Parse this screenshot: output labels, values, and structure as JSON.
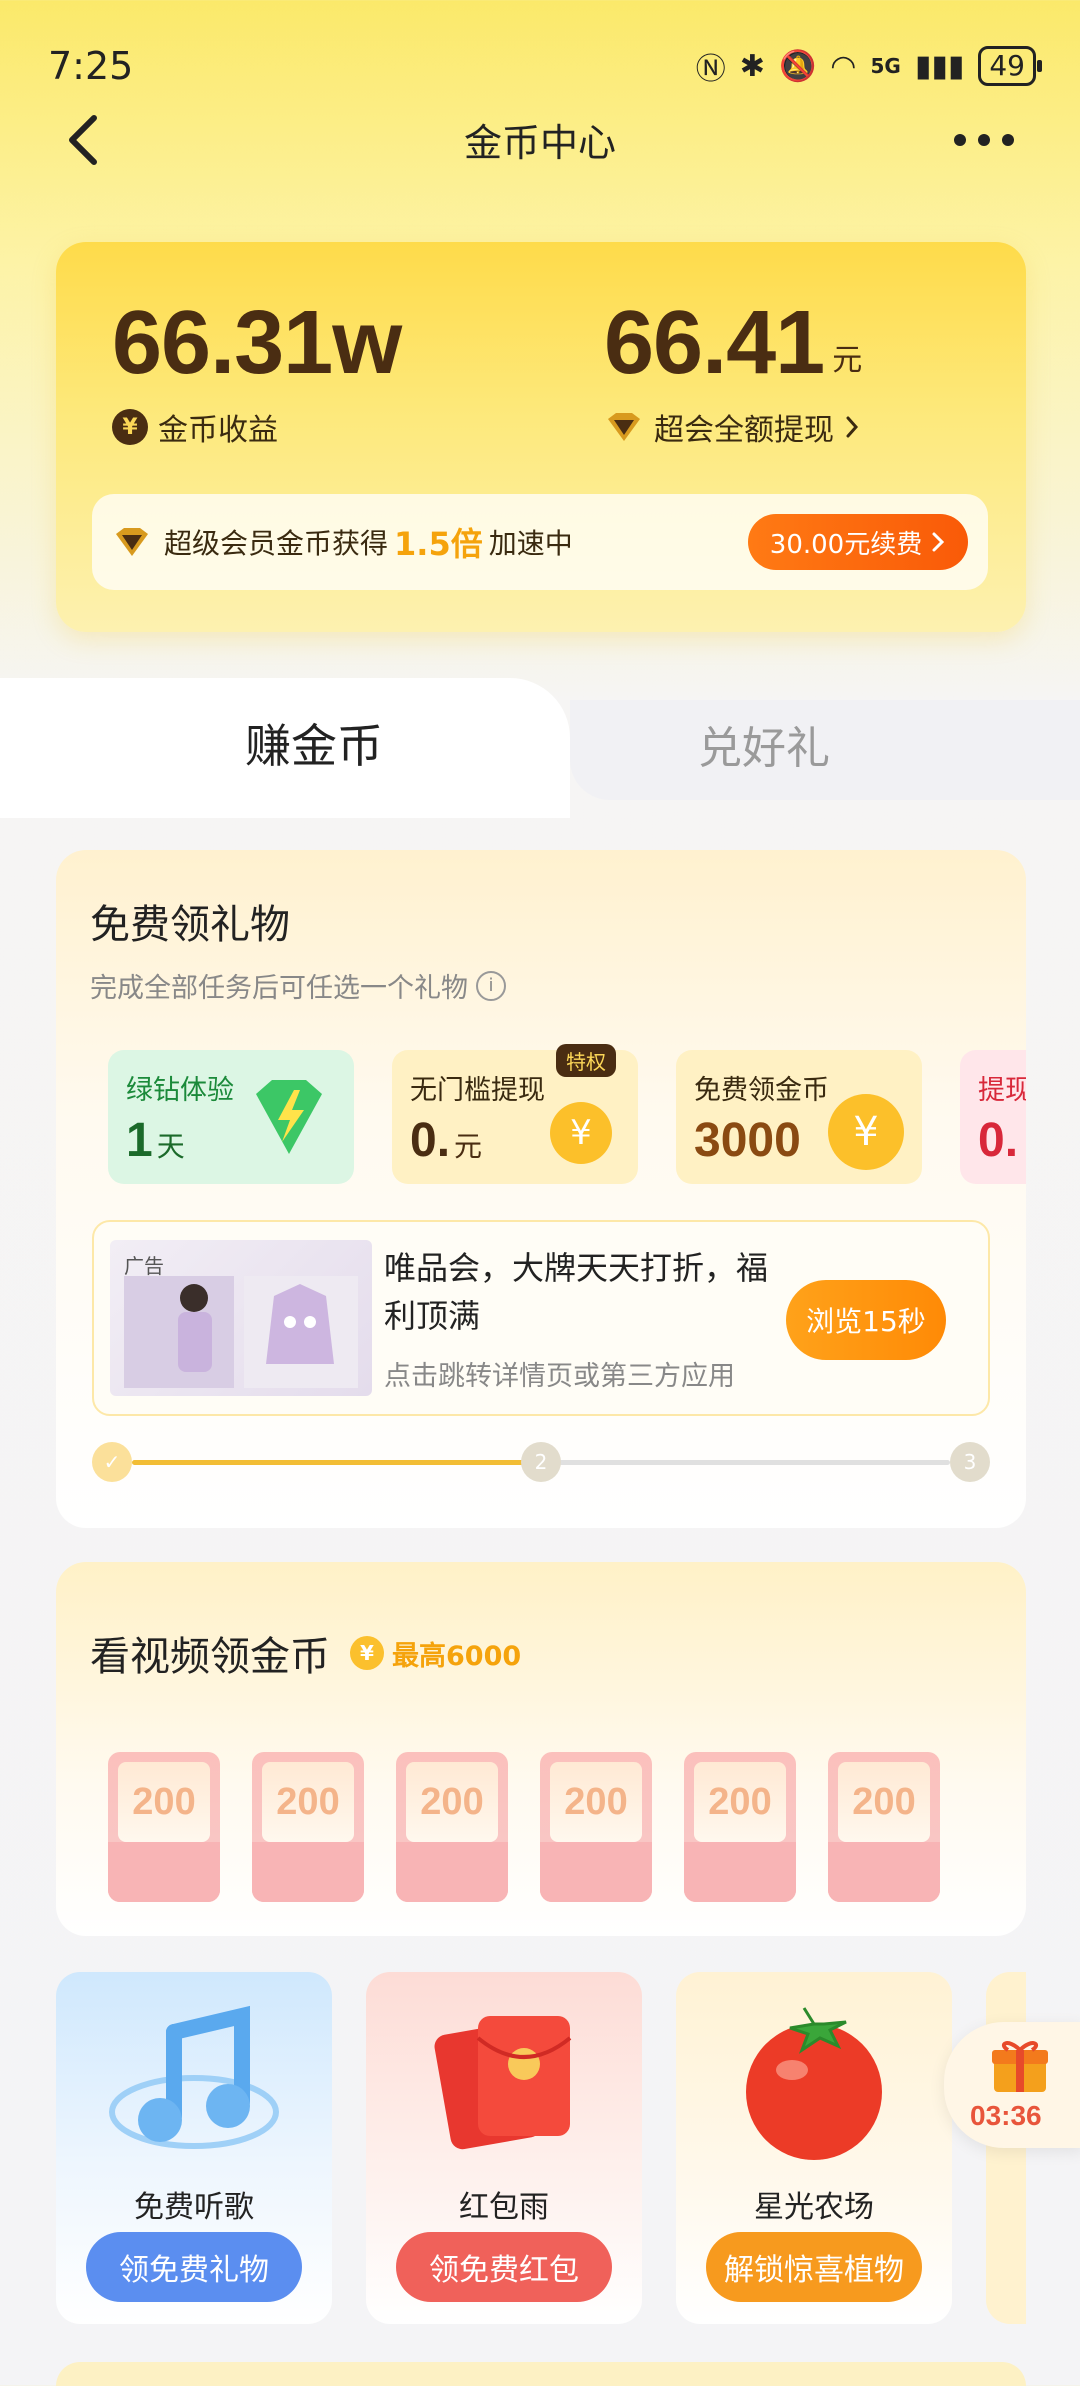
{
  "status": {
    "time": "7:25",
    "battery": "49",
    "network": "5G"
  },
  "nav": {
    "title": "金币中心"
  },
  "balance": {
    "coins_value": "66.31w",
    "coins_label": "金币收益",
    "cash_value": "66.41",
    "cash_unit": "元",
    "cash_label": "超会全额提现",
    "vip_prefix": "超级会员金币获得",
    "vip_multiplier": "1.5倍",
    "vip_suffix": "加速中",
    "renew_label": "30.00元续费"
  },
  "tabs": [
    {
      "label": "赚金币",
      "active": true
    },
    {
      "label": "兑好礼",
      "active": false
    }
  ],
  "gift_section": {
    "title": "免费领礼物",
    "subtitle": "完成全部任务后可任选一个礼物",
    "tiles": [
      {
        "label": "绿钻体验",
        "value": "1",
        "unit": "天",
        "color": "#1b8a3a",
        "bg": "#def7e6"
      },
      {
        "label": "无门槛提现",
        "value": "0.",
        "unit": "元",
        "color": "#4a2d12",
        "bg": "#fff2c6",
        "tag": "特权"
      },
      {
        "label": "免费领金币",
        "value": "3000",
        "unit": "",
        "color": "#8a4a12",
        "bg": "#fff2c6"
      },
      {
        "label": "提现",
        "value": "0.",
        "unit": "",
        "color": "#d8283a",
        "bg": "#ffe6ea"
      }
    ],
    "ad": {
      "tag": "广告",
      "title": "唯品会，大牌天天打折，福利顶满",
      "subtitle": "点击跳转详情页或第三方应用",
      "button": "浏览15秒"
    },
    "steps": [
      "✓",
      "2",
      "3"
    ],
    "progress": 0.5
  },
  "video_section": {
    "title": "看视频领金币",
    "max_label": "最高6000",
    "rewards": [
      "200",
      "200",
      "200",
      "200",
      "200",
      "200"
    ]
  },
  "activities": [
    {
      "name": "免费听歌",
      "button": "领免费礼物",
      "btn_color": "#5b8ef0",
      "bg_top": "#d6ecfd",
      "icon": "music-note-icon"
    },
    {
      "name": "红包雨",
      "button": "领免费红包",
      "btn_color": "#f0615a",
      "bg_top": "#fde0dc",
      "icon": "red-envelope-icon"
    },
    {
      "name": "星光农场",
      "button": "解锁惊喜植物",
      "btn_color": "#f79a1e",
      "bg_top": "#fff2d2",
      "icon": "tomato-icon"
    }
  ],
  "float_timer": {
    "time": "03:36",
    "icon": "gift-box-icon"
  }
}
